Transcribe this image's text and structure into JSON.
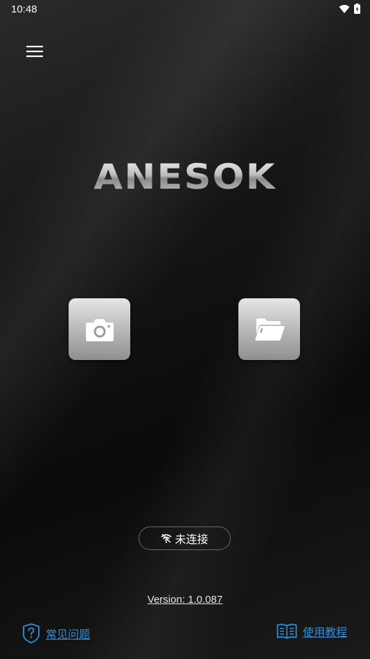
{
  "status_bar": {
    "time": "10:48",
    "icons": [
      "wifi-icon",
      "battery-charging-icon"
    ]
  },
  "header": {
    "menu_icon": "hamburger-menu-icon"
  },
  "brand": {
    "logo_text": "ANESOK"
  },
  "actions": {
    "camera_icon": "camera-icon",
    "folder_icon": "folder-open-icon"
  },
  "connection": {
    "icon": "wifi-off-icon",
    "status": "未连接"
  },
  "footer": {
    "version": "Version: 1.0.087",
    "faq_label": "常见问题",
    "tutorial_label": "使用教程"
  },
  "colors": {
    "background": "#0d0d0d",
    "link": "#2f8fd8",
    "tile_light": "#e6e6e6",
    "tile_dark": "#8f8f8f"
  }
}
